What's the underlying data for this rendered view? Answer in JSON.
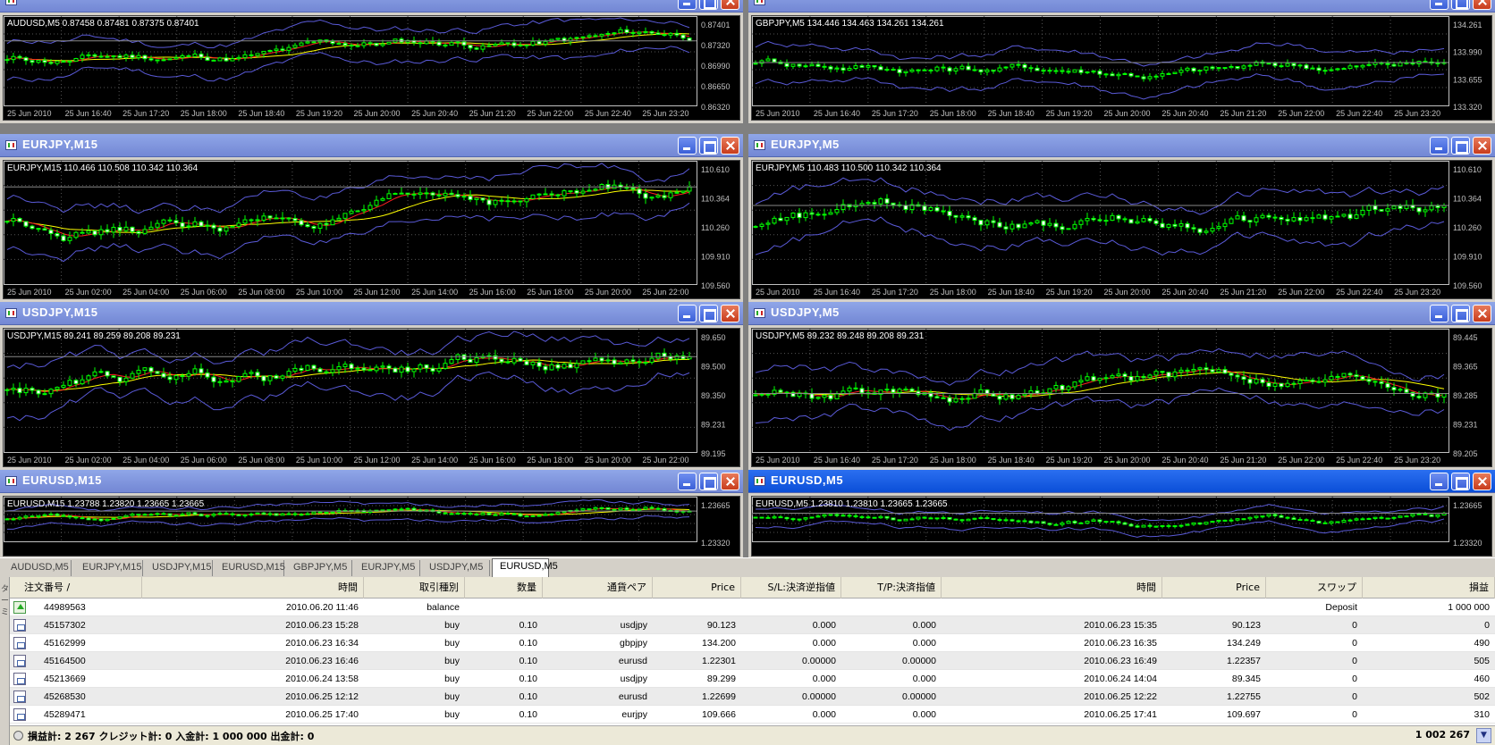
{
  "charts": [
    {
      "id": "aud15",
      "title": "",
      "header": "AUDUSD,M5  0.87458 0.87481 0.87375 0.87401",
      "prices": [
        "0.87401",
        "0.87320",
        "0.86990",
        "0.86650",
        "0.86320"
      ],
      "times": [
        "25 Jun 2010",
        "25 Jun 16:40",
        "25 Jun 17:20",
        "25 Jun 18:00",
        "25 Jun 18:40",
        "25 Jun 19:20",
        "25 Jun 20:00",
        "25 Jun 20:40",
        "25 Jun 21:20",
        "25 Jun 22:00",
        "25 Jun 22:40",
        "25 Jun 23:20"
      ]
    },
    {
      "id": "gbp5",
      "title": "",
      "header": "GBPJPY,M5  134.446 134.463 134.261 134.261",
      "prices": [
        "134.261",
        "133.990",
        "133.655",
        "133.320"
      ],
      "times": [
        "25 Jun 2010",
        "25 Jun 16:40",
        "25 Jun 17:20",
        "25 Jun 18:00",
        "25 Jun 18:40",
        "25 Jun 19:20",
        "25 Jun 20:00",
        "25 Jun 20:40",
        "25 Jun 21:20",
        "25 Jun 22:00",
        "25 Jun 22:40",
        "25 Jun 23:20"
      ]
    },
    {
      "id": "ej15",
      "title": "EURJPY,M15",
      "header": "EURJPY,M15  110.466 110.508 110.342 110.364",
      "prices": [
        "110.610",
        "110.364",
        "110.260",
        "109.910",
        "109.560"
      ],
      "times": [
        "25 Jun 2010",
        "25 Jun 02:00",
        "25 Jun 04:00",
        "25 Jun 06:00",
        "25 Jun 08:00",
        "25 Jun 10:00",
        "25 Jun 12:00",
        "25 Jun 14:00",
        "25 Jun 16:00",
        "25 Jun 18:00",
        "25 Jun 20:00",
        "25 Jun 22:00"
      ]
    },
    {
      "id": "ej5",
      "title": "EURJPY,M5",
      "header": "EURJPY,M5  110.483 110.500 110.342 110.364",
      "prices": [
        "110.610",
        "110.364",
        "110.260",
        "109.910",
        "109.560"
      ],
      "times": [
        "25 Jun 2010",
        "25 Jun 16:40",
        "25 Jun 17:20",
        "25 Jun 18:00",
        "25 Jun 18:40",
        "25 Jun 19:20",
        "25 Jun 20:00",
        "25 Jun 20:40",
        "25 Jun 21:20",
        "25 Jun 22:00",
        "25 Jun 22:40",
        "25 Jun 23:20"
      ]
    },
    {
      "id": "uj15",
      "title": "USDJPY,M15",
      "header": "USDJPY,M15  89.241 89.259 89.208 89.231",
      "prices": [
        "89.650",
        "89.500",
        "89.350",
        "89.231",
        "89.195"
      ],
      "times": [
        "25 Jun 2010",
        "25 Jun 02:00",
        "25 Jun 04:00",
        "25 Jun 06:00",
        "25 Jun 08:00",
        "25 Jun 10:00",
        "25 Jun 12:00",
        "25 Jun 14:00",
        "25 Jun 16:00",
        "25 Jun 18:00",
        "25 Jun 20:00",
        "25 Jun 22:00"
      ]
    },
    {
      "id": "uj5",
      "title": "USDJPY,M5",
      "header": "USDJPY,M5  89.232 89.248 89.208 89.231",
      "prices": [
        "89.445",
        "89.365",
        "89.285",
        "89.231",
        "89.205"
      ],
      "times": [
        "25 Jun 2010",
        "25 Jun 16:40",
        "25 Jun 17:20",
        "25 Jun 18:00",
        "25 Jun 18:40",
        "25 Jun 19:20",
        "25 Jun 20:00",
        "25 Jun 20:40",
        "25 Jun 21:20",
        "25 Jun 22:00",
        "25 Jun 22:40",
        "25 Jun 23:20"
      ]
    },
    {
      "id": "eu15",
      "title": "EURUSD,M15",
      "header": "EURUSD,M15  1.23788 1.23820 1.23665 1.23665",
      "prices": [
        "1.23665",
        "1.23320"
      ],
      "times": []
    },
    {
      "id": "eu5",
      "title": "EURUSD,M5",
      "header": "EURUSD,M5  1.23810 1.23810 1.23665 1.23665",
      "prices": [
        "1.23665",
        "1.23320"
      ],
      "times": []
    }
  ],
  "tabs": [
    "AUDUSD,M5",
    "EURJPY,M15",
    "USDJPY,M15",
    "EURUSD,M15",
    "GBPJPY,M5",
    "EURJPY,M5",
    "USDJPY,M5",
    "EURUSD,M5"
  ],
  "active_tab": "EURUSD,M5",
  "terminal": {
    "side_label": "ターミ",
    "columns": [
      "注文番号",
      "時間",
      "取引種別",
      "数量",
      "通貨ペア",
      "Price",
      "S/L:決済逆指値",
      "T/P:決済指値",
      "時間",
      "Price",
      "スワップ",
      "損益"
    ],
    "sort_mark": "/",
    "rows": [
      {
        "icon": "balance",
        "cells": [
          "44989563",
          "2010.06.20 11:46",
          "balance",
          "",
          "",
          "",
          "",
          "",
          "",
          "",
          "Deposit",
          "1 000 000"
        ]
      },
      {
        "icon": "trade",
        "cells": [
          "45157302",
          "2010.06.23 15:28",
          "buy",
          "0.10",
          "usdjpy",
          "90.123",
          "0.000",
          "0.000",
          "2010.06.23 15:35",
          "90.123",
          "0",
          "0"
        ]
      },
      {
        "icon": "trade",
        "cells": [
          "45162999",
          "2010.06.23 16:34",
          "buy",
          "0.10",
          "gbpjpy",
          "134.200",
          "0.000",
          "0.000",
          "2010.06.23 16:35",
          "134.249",
          "0",
          "490"
        ]
      },
      {
        "icon": "trade",
        "cells": [
          "45164500",
          "2010.06.23 16:46",
          "buy",
          "0.10",
          "eurusd",
          "1.22301",
          "0.00000",
          "0.00000",
          "2010.06.23 16:49",
          "1.22357",
          "0",
          "505"
        ]
      },
      {
        "icon": "trade",
        "cells": [
          "45213669",
          "2010.06.24 13:58",
          "buy",
          "0.10",
          "usdjpy",
          "89.299",
          "0.000",
          "0.000",
          "2010.06.24 14:04",
          "89.345",
          "0",
          "460"
        ]
      },
      {
        "icon": "trade",
        "cells": [
          "45268530",
          "2010.06.25 12:12",
          "buy",
          "0.10",
          "eurusd",
          "1.22699",
          "0.00000",
          "0.00000",
          "2010.06.25 12:22",
          "1.22755",
          "0",
          "502"
        ]
      },
      {
        "icon": "trade",
        "cells": [
          "45289471",
          "2010.06.25 17:40",
          "buy",
          "0.10",
          "eurjpy",
          "109.666",
          "0.000",
          "0.000",
          "2010.06.25 17:41",
          "109.697",
          "0",
          "310"
        ]
      }
    ],
    "summary": "損益計: 2 267  クレジット計: 0  入金計: 1 000 000  出金計: 0",
    "total": "1 002 267"
  },
  "colors": {
    "bull": "#00ff00",
    "bear": "#ffffff",
    "ma_fast": "#ff2020",
    "ma_slow": "#ffff00",
    "band": "#5a5ad8",
    "titlebar": "#7a8fe0",
    "titlebar_active": "#0b4fd8"
  }
}
